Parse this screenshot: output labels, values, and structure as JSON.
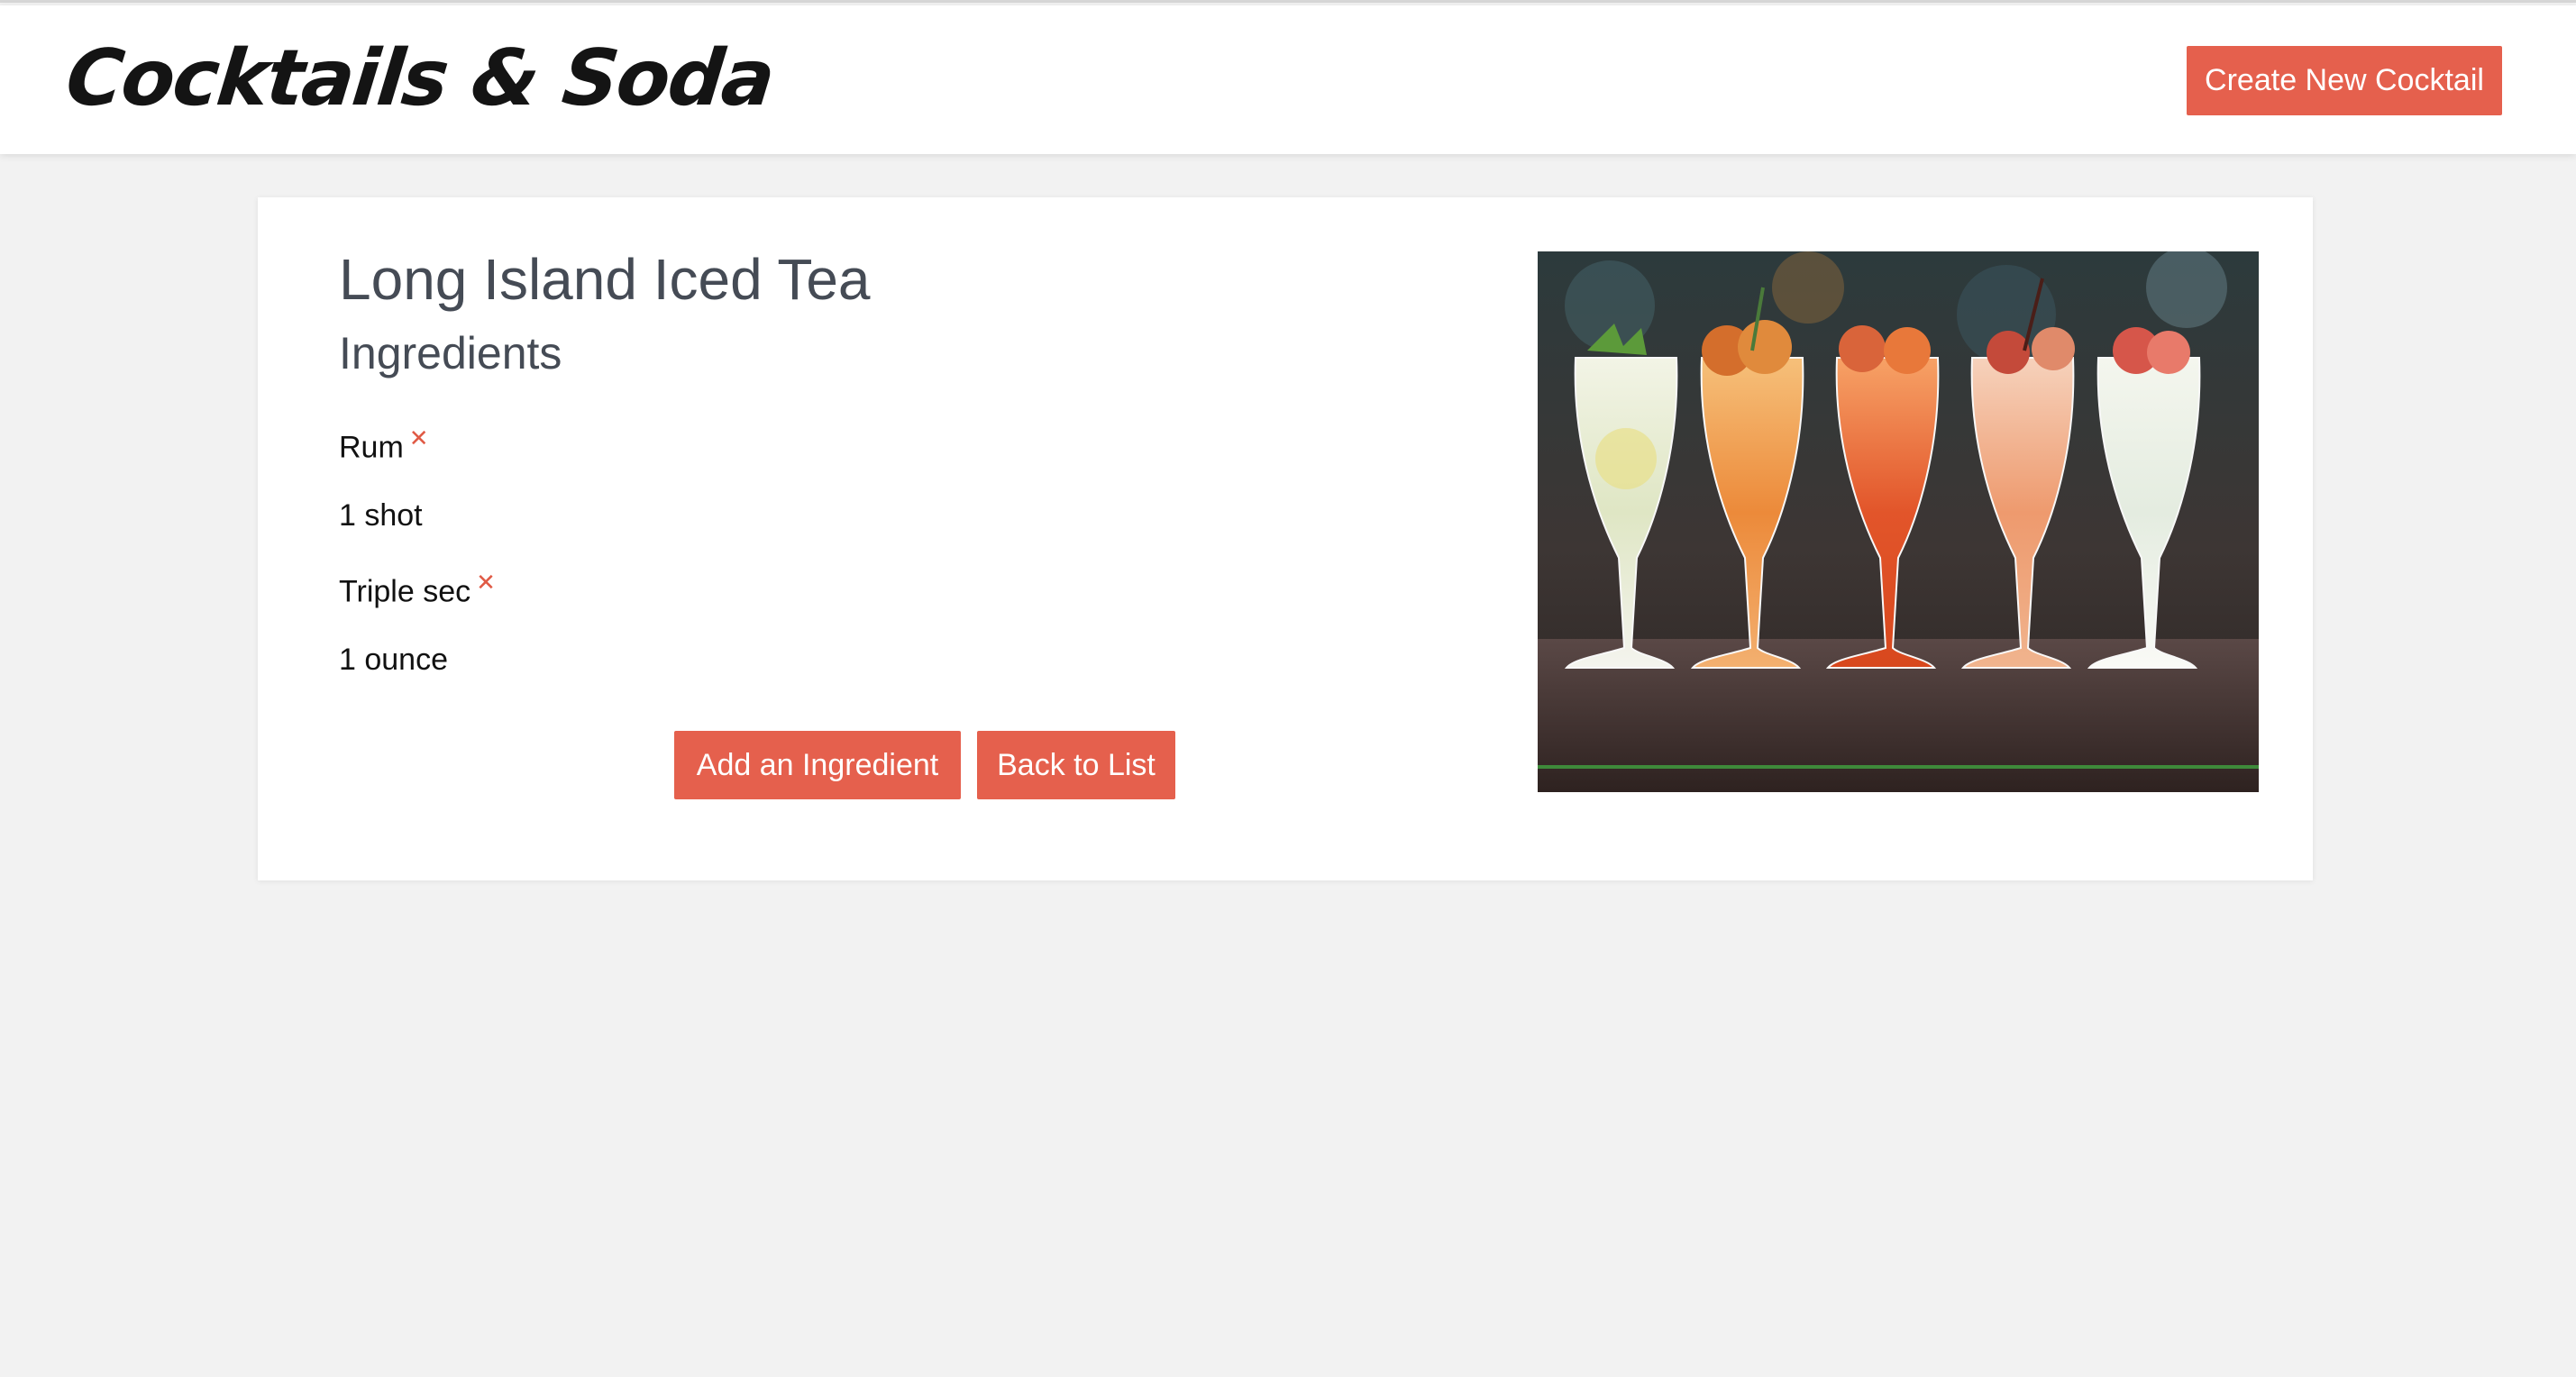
{
  "header": {
    "brand": "Cocktails & Soda",
    "create_label": "Create New Cocktail"
  },
  "cocktail": {
    "name": "Long Island Iced Tea",
    "ingredients_heading": "Ingredients",
    "ingredients": [
      {
        "name": "Rum",
        "amount": "1 shot"
      },
      {
        "name": "Triple sec",
        "amount": "1 ounce"
      }
    ],
    "remove_icon": "close-icon",
    "add_label": "Add an Ingredient",
    "back_label": "Back to List"
  },
  "colors": {
    "accent": "#e5604d",
    "heading": "#454b55",
    "background": "#f2f2f2"
  }
}
